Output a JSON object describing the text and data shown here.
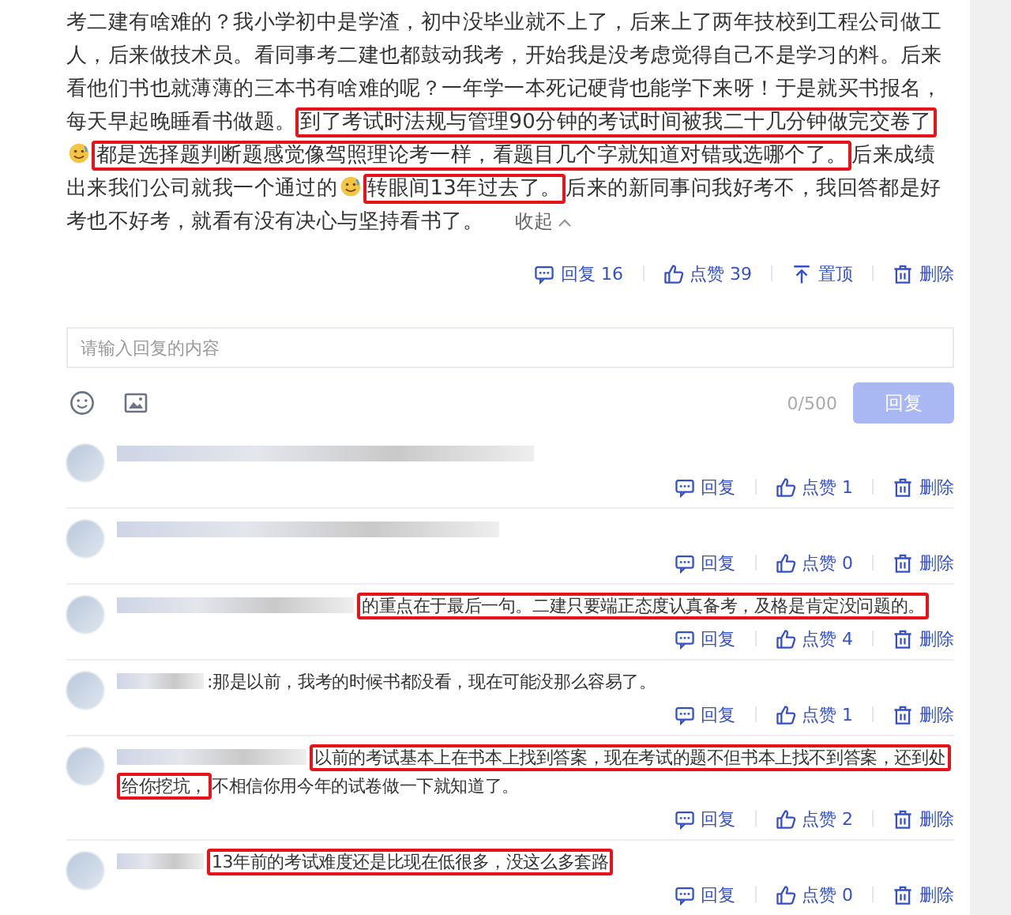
{
  "post": {
    "segments": [
      {
        "kind": "text",
        "text": "考二建有啥难的？我小学初中是学渣，初中没毕业就不上了，后来上了两年技校到工程公司做工人，后来做技术员。看同事考二建也都鼓动我考，开始我是没考虑觉得自己不是学习的料。后来看他们书也就薄薄的三本书有啥难的呢？一年学一本死记硬背也能学下来呀！于是就买书报名，每天早起晚睡看书做题。",
        "highlighted": false
      },
      {
        "kind": "text",
        "text": "到了考试时法规与管理90分钟的考试时间被我二十几分钟做完交卷了",
        "highlighted": true
      },
      {
        "kind": "emoji"
      },
      {
        "kind": "text",
        "text": "都是选择题判断题感觉像驾照理论考一样，看题目几个字就知道对错或选哪个了。",
        "highlighted": true
      },
      {
        "kind": "text",
        "text": "后来成绩出来我们公司就我一个通过的",
        "highlighted": false
      },
      {
        "kind": "emoji"
      },
      {
        "kind": "text",
        "text": "转眼间13年过去了。",
        "highlighted": true
      },
      {
        "kind": "text",
        "text": "后来的新同事问我好考不，我回答都是好考也不好考，就看有没有决心与坚持看书了。",
        "highlighted": false
      }
    ],
    "collapse": "收起",
    "actions": [
      {
        "kind": "reply",
        "label": "回复 16"
      },
      {
        "kind": "like",
        "label": "点赞 39"
      },
      {
        "kind": "pin",
        "label": "置顶"
      },
      {
        "kind": "delete",
        "label": "删除"
      }
    ]
  },
  "reply_box": {
    "placeholder": "请输入回复的内容",
    "counter": "0/500",
    "submit": "回复",
    "submit_disabled": true
  },
  "replies": [
    {
      "actions": [
        {
          "kind": "reply",
          "label": "回复"
        },
        {
          "kind": "like",
          "label": "点赞 1"
        },
        {
          "kind": "delete",
          "label": "删除"
        }
      ]
    },
    {
      "actions": [
        {
          "kind": "reply",
          "label": "回复"
        },
        {
          "kind": "like",
          "label": "点赞 0"
        },
        {
          "kind": "delete",
          "label": "删除"
        }
      ]
    },
    {
      "text": "的重点在于最后一句。二建只要端正态度认真备考，及格是肯定没问题的。",
      "highlighted": true,
      "actions": [
        {
          "kind": "reply",
          "label": "回复"
        },
        {
          "kind": "like",
          "label": "点赞 4"
        },
        {
          "kind": "delete",
          "label": "删除"
        }
      ]
    },
    {
      "text": ":那是以前，我考的时候书都没看，现在可能没那么容易了。",
      "highlighted": false,
      "actions": [
        {
          "kind": "reply",
          "label": "回复"
        },
        {
          "kind": "like",
          "label": "点赞 1"
        },
        {
          "kind": "delete",
          "label": "删除"
        }
      ]
    },
    {
      "text": "以前的考试基本上在书本上找到答案，现在考试的题不但书本上找不到答案，还到处给你挖坑，",
      "highlighted": true,
      "text_after": "不相信你用今年的试卷做一下就知道了。",
      "actions": [
        {
          "kind": "reply",
          "label": "回复"
        },
        {
          "kind": "like",
          "label": "点赞 2"
        },
        {
          "kind": "delete",
          "label": "删除"
        }
      ]
    },
    {
      "text": "13年前的考试难度还是比现在低很多，没这么多套路",
      "highlighted": true,
      "actions": [
        {
          "kind": "reply",
          "label": "回复"
        },
        {
          "kind": "like",
          "label": "点赞 0"
        },
        {
          "kind": "delete",
          "label": "删除"
        }
      ]
    }
  ]
}
